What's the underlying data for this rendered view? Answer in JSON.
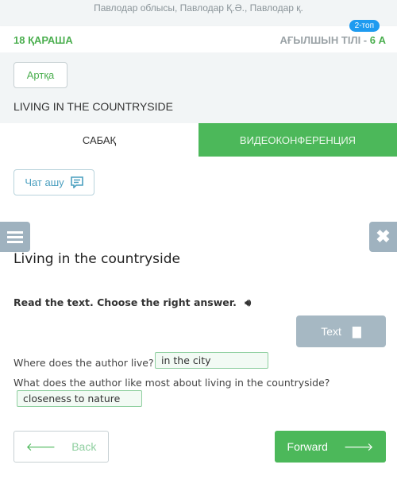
{
  "location": "Павлодар облысы, Павлодар Қ.Ә., Павлодар қ.",
  "header": {
    "date": "18 ҚАРАША",
    "subject": "АҒЫЛШЫН ТІЛІ - ",
    "class": "6 А",
    "badge": "2-топ"
  },
  "back_top": "Артқа",
  "lesson_title": "LIVING IN THE COUNTRYSIDE",
  "tabs": [
    {
      "label": "САБАҚ",
      "active": true
    },
    {
      "label": "ВИДЕОКОНФЕРЕНЦИЯ",
      "active": false
    }
  ],
  "chat_label": "Чат ашу",
  "task": {
    "title": "Living in the countryside",
    "instruction": "Read the text. Choose the right answer.",
    "text_button": "Text",
    "questions": [
      {
        "q": "Where does the author live?",
        "answer": "in the city"
      },
      {
        "q": "What does the author like most about living in the countryside?",
        "answer": "closeness to nature"
      }
    ]
  },
  "nav": {
    "back": "Back",
    "forward": "Forward"
  },
  "colors": {
    "green": "#4cb85a",
    "grey_button": "#a6b8c3",
    "badge": "#1e9bf0"
  }
}
